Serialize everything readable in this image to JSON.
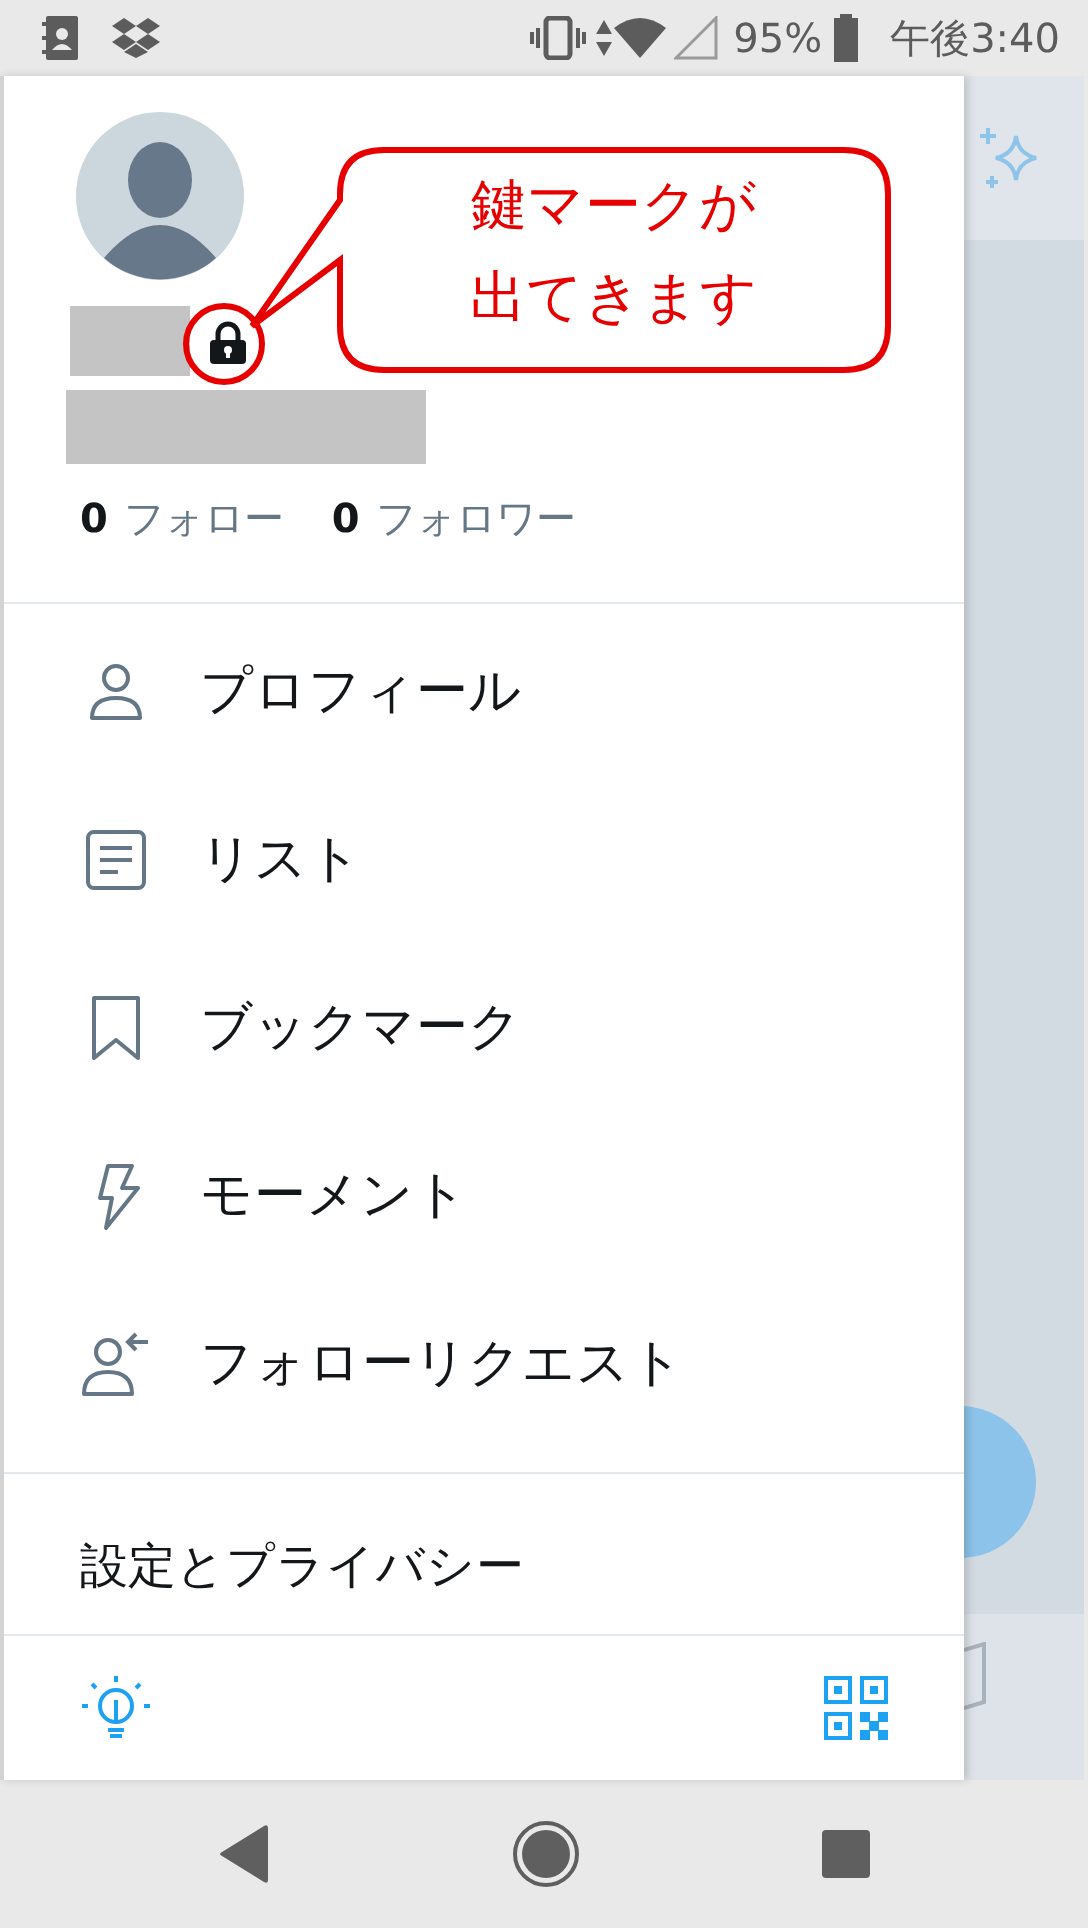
{
  "status_bar": {
    "battery": "95%",
    "time": "午後3:40"
  },
  "profile": {
    "locked": true,
    "following_count": "0",
    "following_label": "フォロー",
    "followers_count": "0",
    "followers_label": "フォロワー"
  },
  "annotation": {
    "lines": [
      "鍵マークが",
      "出てきます"
    ]
  },
  "menu": [
    {
      "kind": "person",
      "label": "プロフィール"
    },
    {
      "kind": "list",
      "label": "リスト"
    },
    {
      "kind": "bookmark",
      "label": "ブックマーク"
    },
    {
      "kind": "bolt",
      "label": "モーメント"
    },
    {
      "kind": "request",
      "label": "フォローリクエスト"
    }
  ],
  "settings": {
    "label": "設定とプライバシー"
  }
}
